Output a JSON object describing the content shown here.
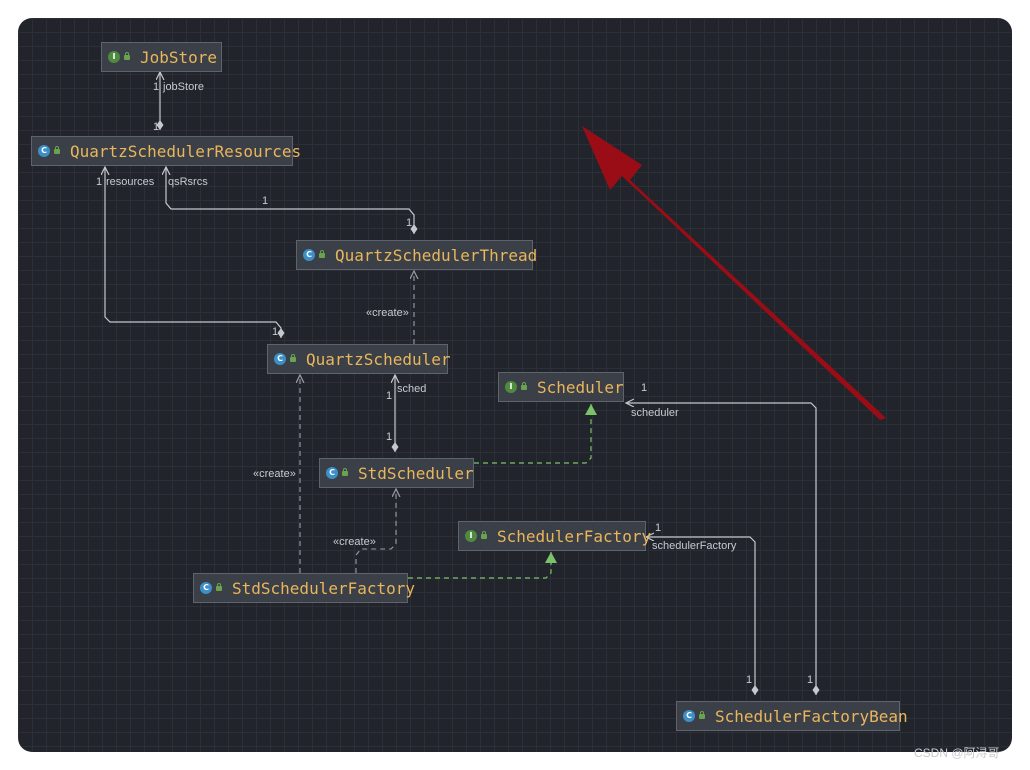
{
  "diagram": {
    "nodes": [
      {
        "id": "jobstore",
        "kind": "interface",
        "badge": "I",
        "name": "JobStore"
      },
      {
        "id": "qsr",
        "kind": "class",
        "badge": "C",
        "name": "QuartzSchedulerResources"
      },
      {
        "id": "qst",
        "kind": "class",
        "badge": "C",
        "name": "QuartzSchedulerThread"
      },
      {
        "id": "qs",
        "kind": "class",
        "badge": "C",
        "name": "QuartzScheduler"
      },
      {
        "id": "scheduler",
        "kind": "interface",
        "badge": "I",
        "name": "Scheduler"
      },
      {
        "id": "stdsched",
        "kind": "class",
        "badge": "C",
        "name": "StdScheduler"
      },
      {
        "id": "schedfactory",
        "kind": "interface",
        "badge": "I",
        "name": "SchedulerFactory"
      },
      {
        "id": "stdschedfactory",
        "kind": "class",
        "badge": "C",
        "name": "StdSchedulerFactory"
      },
      {
        "id": "sfb",
        "kind": "class",
        "badge": "C",
        "name": "SchedulerFactoryBean"
      }
    ],
    "edges": [
      {
        "from": "qsr",
        "to": "jobstore",
        "type": "composition",
        "role": "jobStore",
        "target_mult": "1",
        "source_mult": "1"
      },
      {
        "from": "qst",
        "to": "qsr",
        "type": "composition",
        "role": "qsRsrcs",
        "target_mult": "1",
        "source_mult": "1"
      },
      {
        "from": "qs",
        "to": "qsr",
        "type": "composition",
        "role": "resources",
        "target_mult": "1",
        "source_mult": "1"
      },
      {
        "from": "qs",
        "to": "qst",
        "type": "dependency",
        "stereotype": "«create»"
      },
      {
        "from": "stdsched",
        "to": "qs",
        "type": "composition",
        "role": "sched",
        "target_mult": "1",
        "source_mult": "1"
      },
      {
        "from": "stdsched",
        "to": "scheduler",
        "type": "realization"
      },
      {
        "from": "stdschedfactory",
        "to": "qs",
        "type": "dependency",
        "stereotype": "«create»"
      },
      {
        "from": "stdschedfactory",
        "to": "stdsched",
        "type": "dependency",
        "stereotype": "«create»"
      },
      {
        "from": "stdschedfactory",
        "to": "schedfactory",
        "type": "realization"
      },
      {
        "from": "sfb",
        "to": "scheduler",
        "type": "composition",
        "role": "scheduler",
        "target_mult": "1",
        "source_mult": "1"
      },
      {
        "from": "sfb",
        "to": "schedfactory",
        "type": "composition",
        "role": "schedulerFactory",
        "target_mult": "1",
        "source_mult": "1"
      }
    ]
  },
  "colors": {
    "background": "#22242b",
    "node_fill": "#3b3f47",
    "node_name": "#e9b65c",
    "association": "#c5c8ce",
    "realization": "#7cc26a",
    "dependency": "#9a9ea6",
    "highlight_arrow": "#9a0d16"
  },
  "highlight_arrow": {
    "icon": "red-pointer-arrow-icon"
  },
  "watermark": "CSDN @阿浔哥"
}
